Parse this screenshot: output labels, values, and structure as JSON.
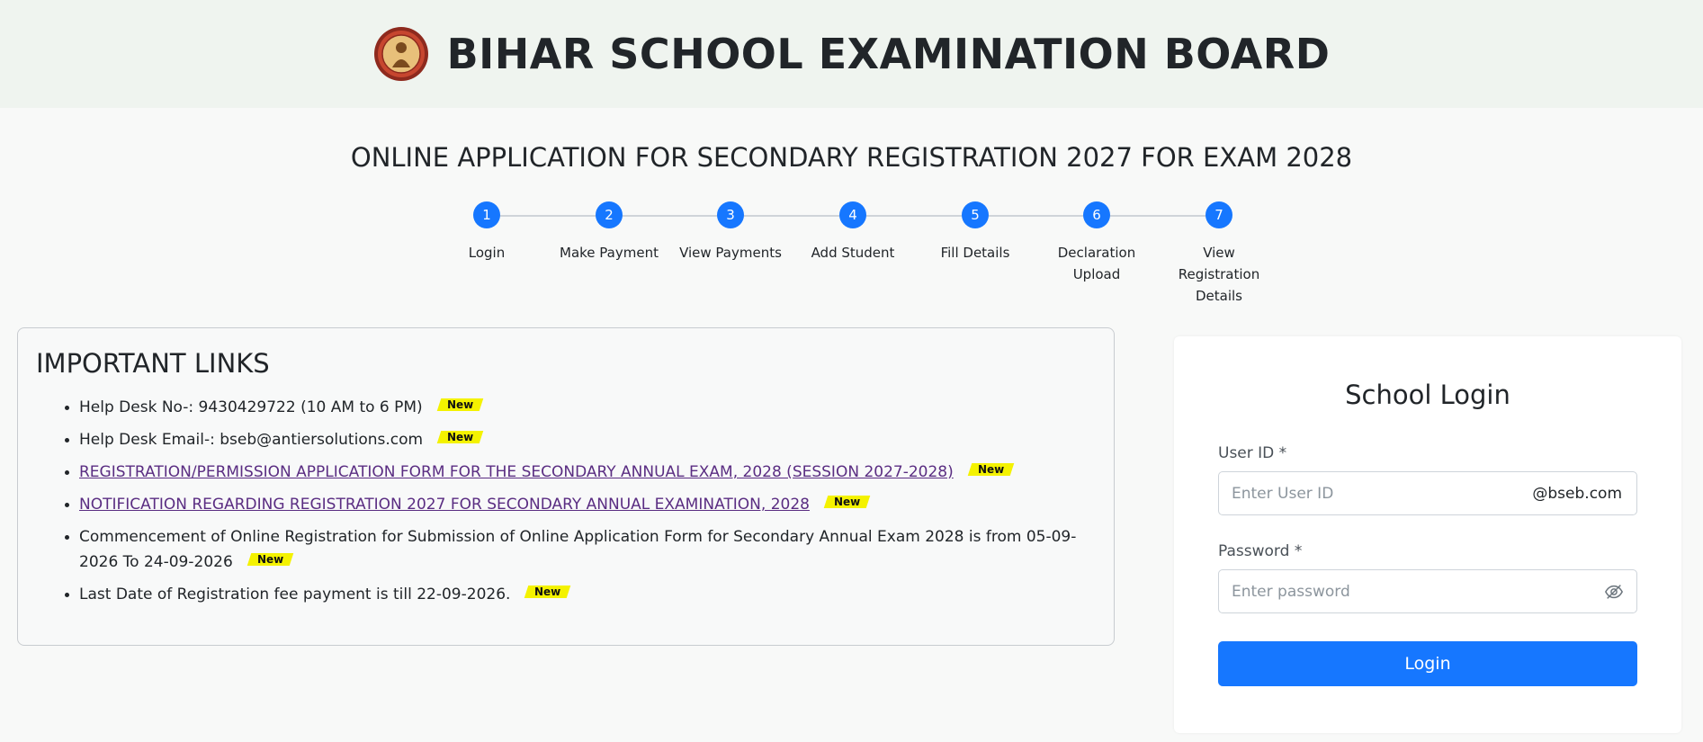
{
  "header": {
    "title": "BIHAR SCHOOL EXAMINATION BOARD"
  },
  "page": {
    "title": "ONLINE APPLICATION FOR SECONDARY REGISTRATION 2027 FOR EXAM 2028"
  },
  "steps": [
    {
      "number": "1",
      "label": "Login"
    },
    {
      "number": "2",
      "label": "Make Payment"
    },
    {
      "number": "3",
      "label": "View Payments"
    },
    {
      "number": "4",
      "label": "Add Student"
    },
    {
      "number": "5",
      "label": "Fill Details"
    },
    {
      "number": "6",
      "label": "Declaration\nUpload"
    },
    {
      "number": "7",
      "label": "View\nRegistration\nDetails"
    }
  ],
  "important_links": {
    "title": "IMPORTANT LINKS",
    "badge": "New",
    "items": [
      {
        "text": "Help Desk No-: 9430429722 (10 AM to 6 PM)"
      },
      {
        "text": "Help Desk Email-: bseb@antiersolutions.com"
      },
      {
        "text": "REGISTRATION/PERMISSION APPLICATION FORM FOR THE SECONDARY ANNUAL EXAM, 2028 (SESSION 2027-2028)"
      },
      {
        "text": "NOTIFICATION REGARDING REGISTRATION 2027 FOR SECONDARY ANNUAL EXAMINATION, 2028"
      },
      {
        "text": "Commencement of Online Registration for Submission of Online Application Form for Secondary Annual Exam 2028 is from 05-09-2026 To 24-09-2026"
      },
      {
        "text": "Last Date of Registration fee payment is till 22-09-2026."
      }
    ]
  },
  "login": {
    "title": "School Login",
    "user_id_label": "User ID",
    "user_id_placeholder": "Enter User ID",
    "user_id_suffix": "@bseb.com",
    "password_label": "Password",
    "password_placeholder": "Enter password",
    "required_mark": "*",
    "button_label": "Login"
  },
  "colors": {
    "primary": "#1677ff",
    "badge": "#f4f200",
    "link": "#5a2d82"
  }
}
